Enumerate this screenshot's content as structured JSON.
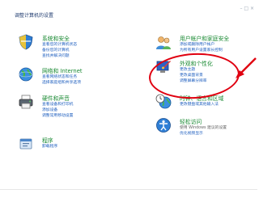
{
  "header": {
    "title": "调整计算机的设置",
    "window_controls": "– □ ×"
  },
  "left": [
    {
      "id": "system",
      "name": "系统和安全",
      "links": [
        "查看您的计算机状态",
        "备份您的计算机",
        "查找并解决问题"
      ],
      "icon": "shield-icon"
    },
    {
      "id": "network",
      "name": "网络和 Internet",
      "links": [
        "查看网络状态和任务",
        "选择家庭组和共享选项"
      ],
      "icon": "globe-network-icon"
    },
    {
      "id": "hardware",
      "name": "硬件和声音",
      "links": [
        "查看设备和打印机",
        "添加设备",
        "调整常用移动设置"
      ],
      "icon": "printer-icon"
    },
    {
      "id": "programs",
      "name": "程序",
      "links": [
        "卸载程序"
      ],
      "icon": "programs-icon"
    }
  ],
  "right": [
    {
      "id": "users",
      "name": "用户帐户和家庭安全",
      "links": [
        "添加或删除用户帐户",
        "为所有用户设置家长控制"
      ],
      "icon": "users-icon"
    },
    {
      "id": "appearance",
      "name": "外观和个性化",
      "links": [
        "更改主题",
        "更改桌面背景",
        "调整屏幕分辨率"
      ],
      "icon": "appearance-icon"
    },
    {
      "id": "clock",
      "name": "时钟、语言和区域",
      "links": [
        "更改键盘或其他输入法"
      ],
      "icon": "clock-globe-icon"
    },
    {
      "id": "ease",
      "name": "轻松访问",
      "links": [
        "使用 Windows 建议的设置",
        "优化视频显示"
      ],
      "icon": "ease-of-access-icon"
    }
  ],
  "colors": {
    "category": "#1a8a33",
    "link": "#1f5fbf",
    "annotation": "#e00010"
  }
}
